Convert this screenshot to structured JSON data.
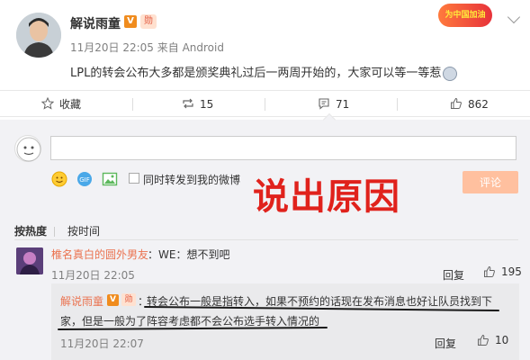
{
  "post": {
    "author": "解说雨童",
    "v_badge": "V",
    "medal": "勋",
    "time": "11月20日 22:05",
    "source": "来自 Android",
    "text": "LPL的转会公布大多都是颁奖典礼过后一两周开始的，大家可以等一等惹",
    "banner": "为中国加油"
  },
  "actions": {
    "favorite_label": "收藏",
    "repost_count": "15",
    "comment_count": "71",
    "like_count": "862"
  },
  "composer": {
    "input_value": "",
    "also_repost_label": "同时转发到我的微博",
    "submit_label": "评论",
    "overlay_text": "说出原因"
  },
  "sort": {
    "hot_label": "按热度",
    "time_label": "按时间"
  },
  "comment": {
    "user": "椎名真白的圆外男友",
    "text": "：WE：想不到吧",
    "time": "11月20日 22:05",
    "report_label": "回复",
    "like_count": "195"
  },
  "reply": {
    "user": "解说雨童",
    "v_badge": "V",
    "medal": "勋",
    "colon": "：",
    "text_line1": "转会公布一般是指转入，如果不预约的话现在发布消息也好让队员找到下",
    "text_line2": "家，但是一般为了阵容考虑都不会公布选手转入情况的",
    "time": "11月20日 22:07",
    "report_label": "回复",
    "like_count": "10"
  },
  "colors": {
    "accent": "#eb7350",
    "overlay_red": "#e0221c",
    "submit_disabled": "#ffc09f",
    "panel_bg": "#f2f2f5"
  }
}
